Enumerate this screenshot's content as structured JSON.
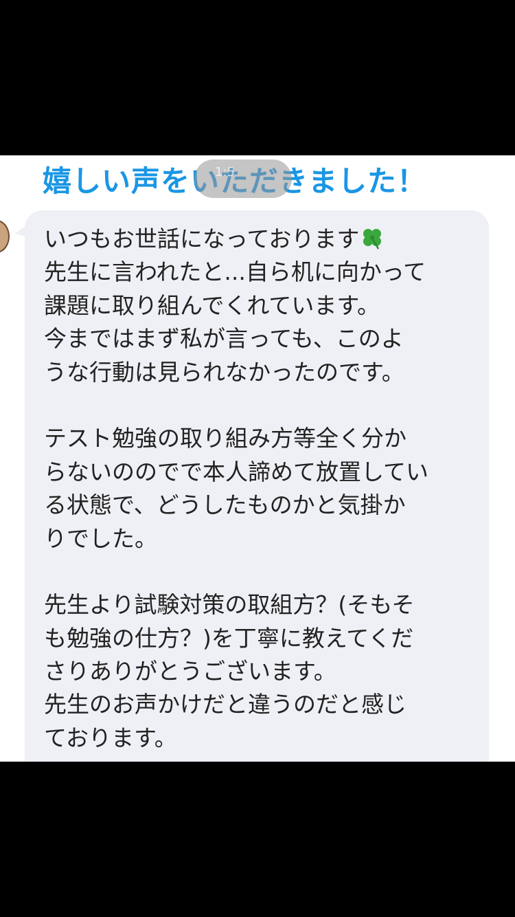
{
  "headline": "嬉しい声をいただきました！",
  "overlay_text": "1:5",
  "message": {
    "lines": [
      "いつもお世話になっております",
      "先生に言われたと...自ら机に向かって",
      "課題に取り組んでくれています。",
      "今まではまず私が言っても、このよ",
      "うな行動は見られなかったのです。",
      "テスト勉強の取り組み方等全く分か",
      "らないののでで本人諦めて放置してい",
      "る状態で、どうしたものかと気掛か",
      "りでした。",
      "先生より試験対策の取組方？(そもそ",
      "も勉強の仕方？)を丁寧に教えてくだ",
      "さりありがとうございます。",
      "先生のお声かけだと違うのだと感じ",
      "ております。"
    ],
    "emoji": "clover-icon"
  },
  "colors": {
    "headline": "#1a96e4",
    "bubble": "#eff0f5",
    "text": "#222222",
    "clover": "#3aa83c"
  }
}
